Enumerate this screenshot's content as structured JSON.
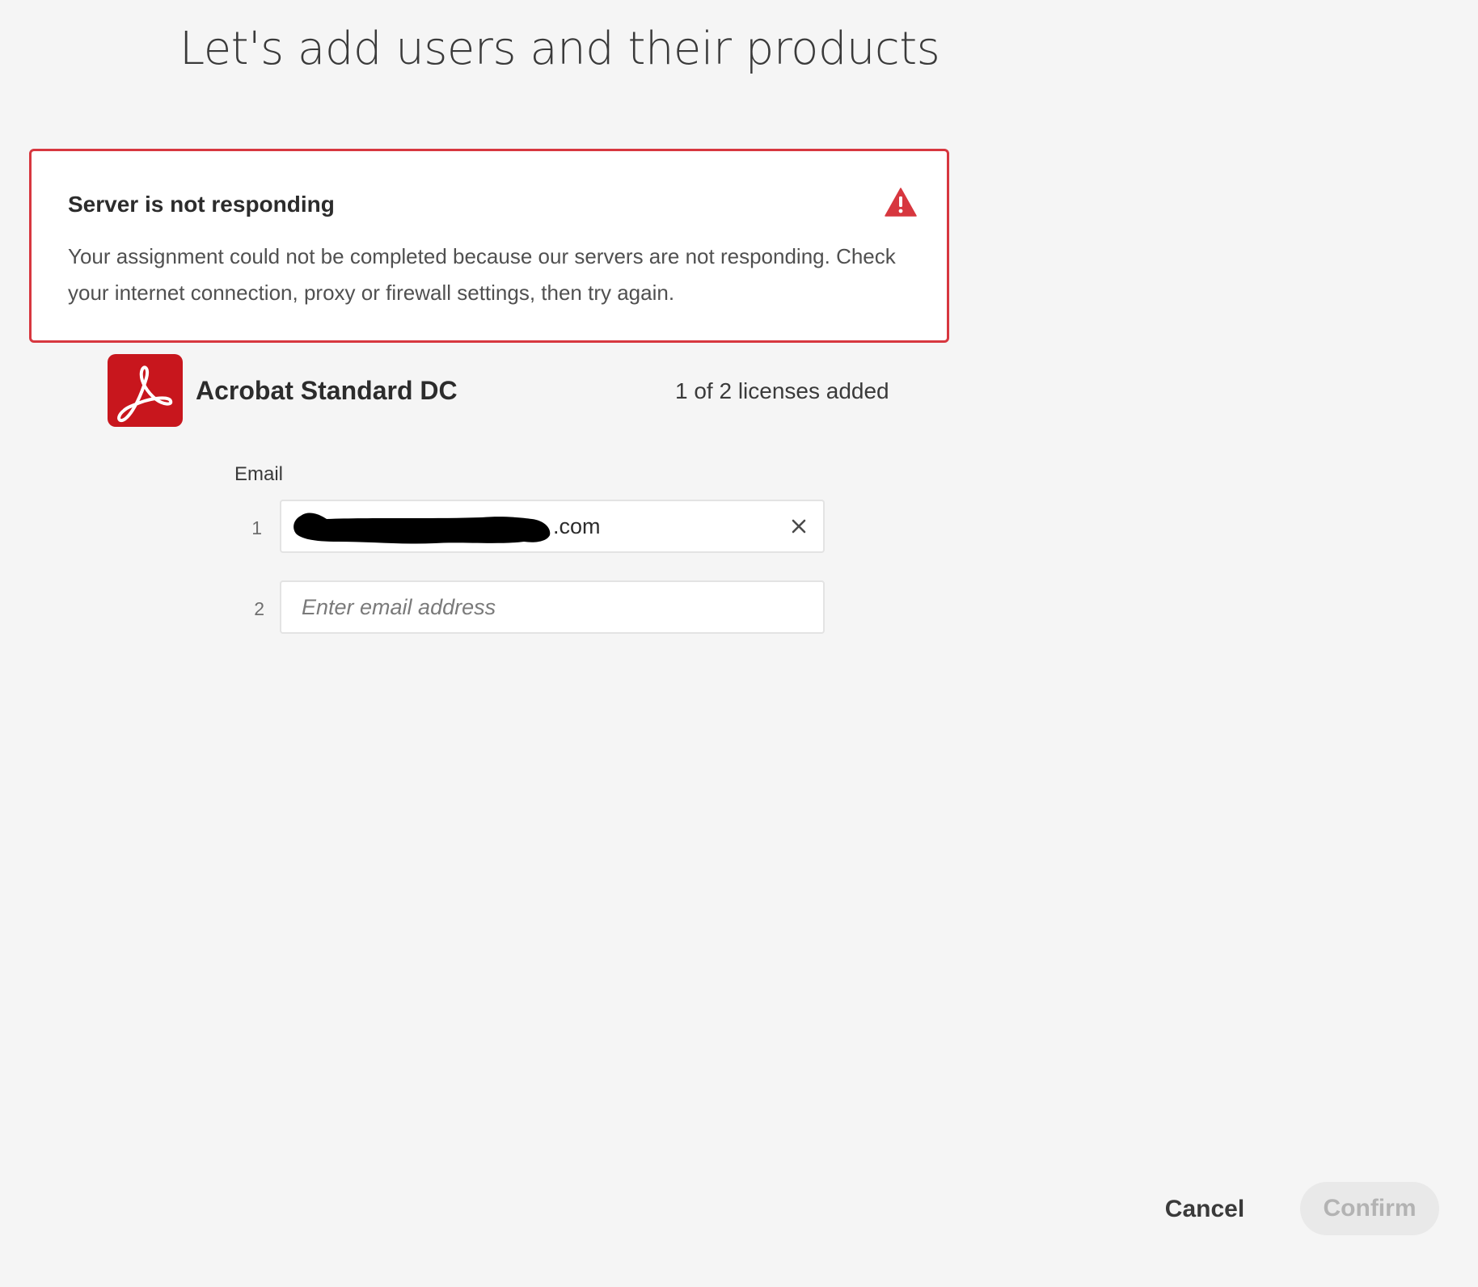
{
  "page": {
    "title": "Let's add users and their products"
  },
  "error": {
    "heading": "Server is not responding",
    "message": "Your assignment could not be completed because our servers are not responding. Check your internet connection, proxy or firewall settings, then try again.",
    "icon": "alert-triangle-icon",
    "color": "#d7373f"
  },
  "product": {
    "name": "Acrobat Standard DC",
    "license_status": "1 of 2 licenses added",
    "icon": "acrobat-logo-icon",
    "brand_color": "#c8161d"
  },
  "email_section": {
    "label": "Email",
    "rows": [
      {
        "number": "1",
        "value": ".com",
        "redacted": true,
        "clear_icon": "close-icon"
      },
      {
        "number": "2",
        "value": "",
        "placeholder": "Enter email address"
      }
    ]
  },
  "actions": {
    "cancel_label": "Cancel",
    "confirm_label": "Confirm",
    "confirm_enabled": false
  }
}
